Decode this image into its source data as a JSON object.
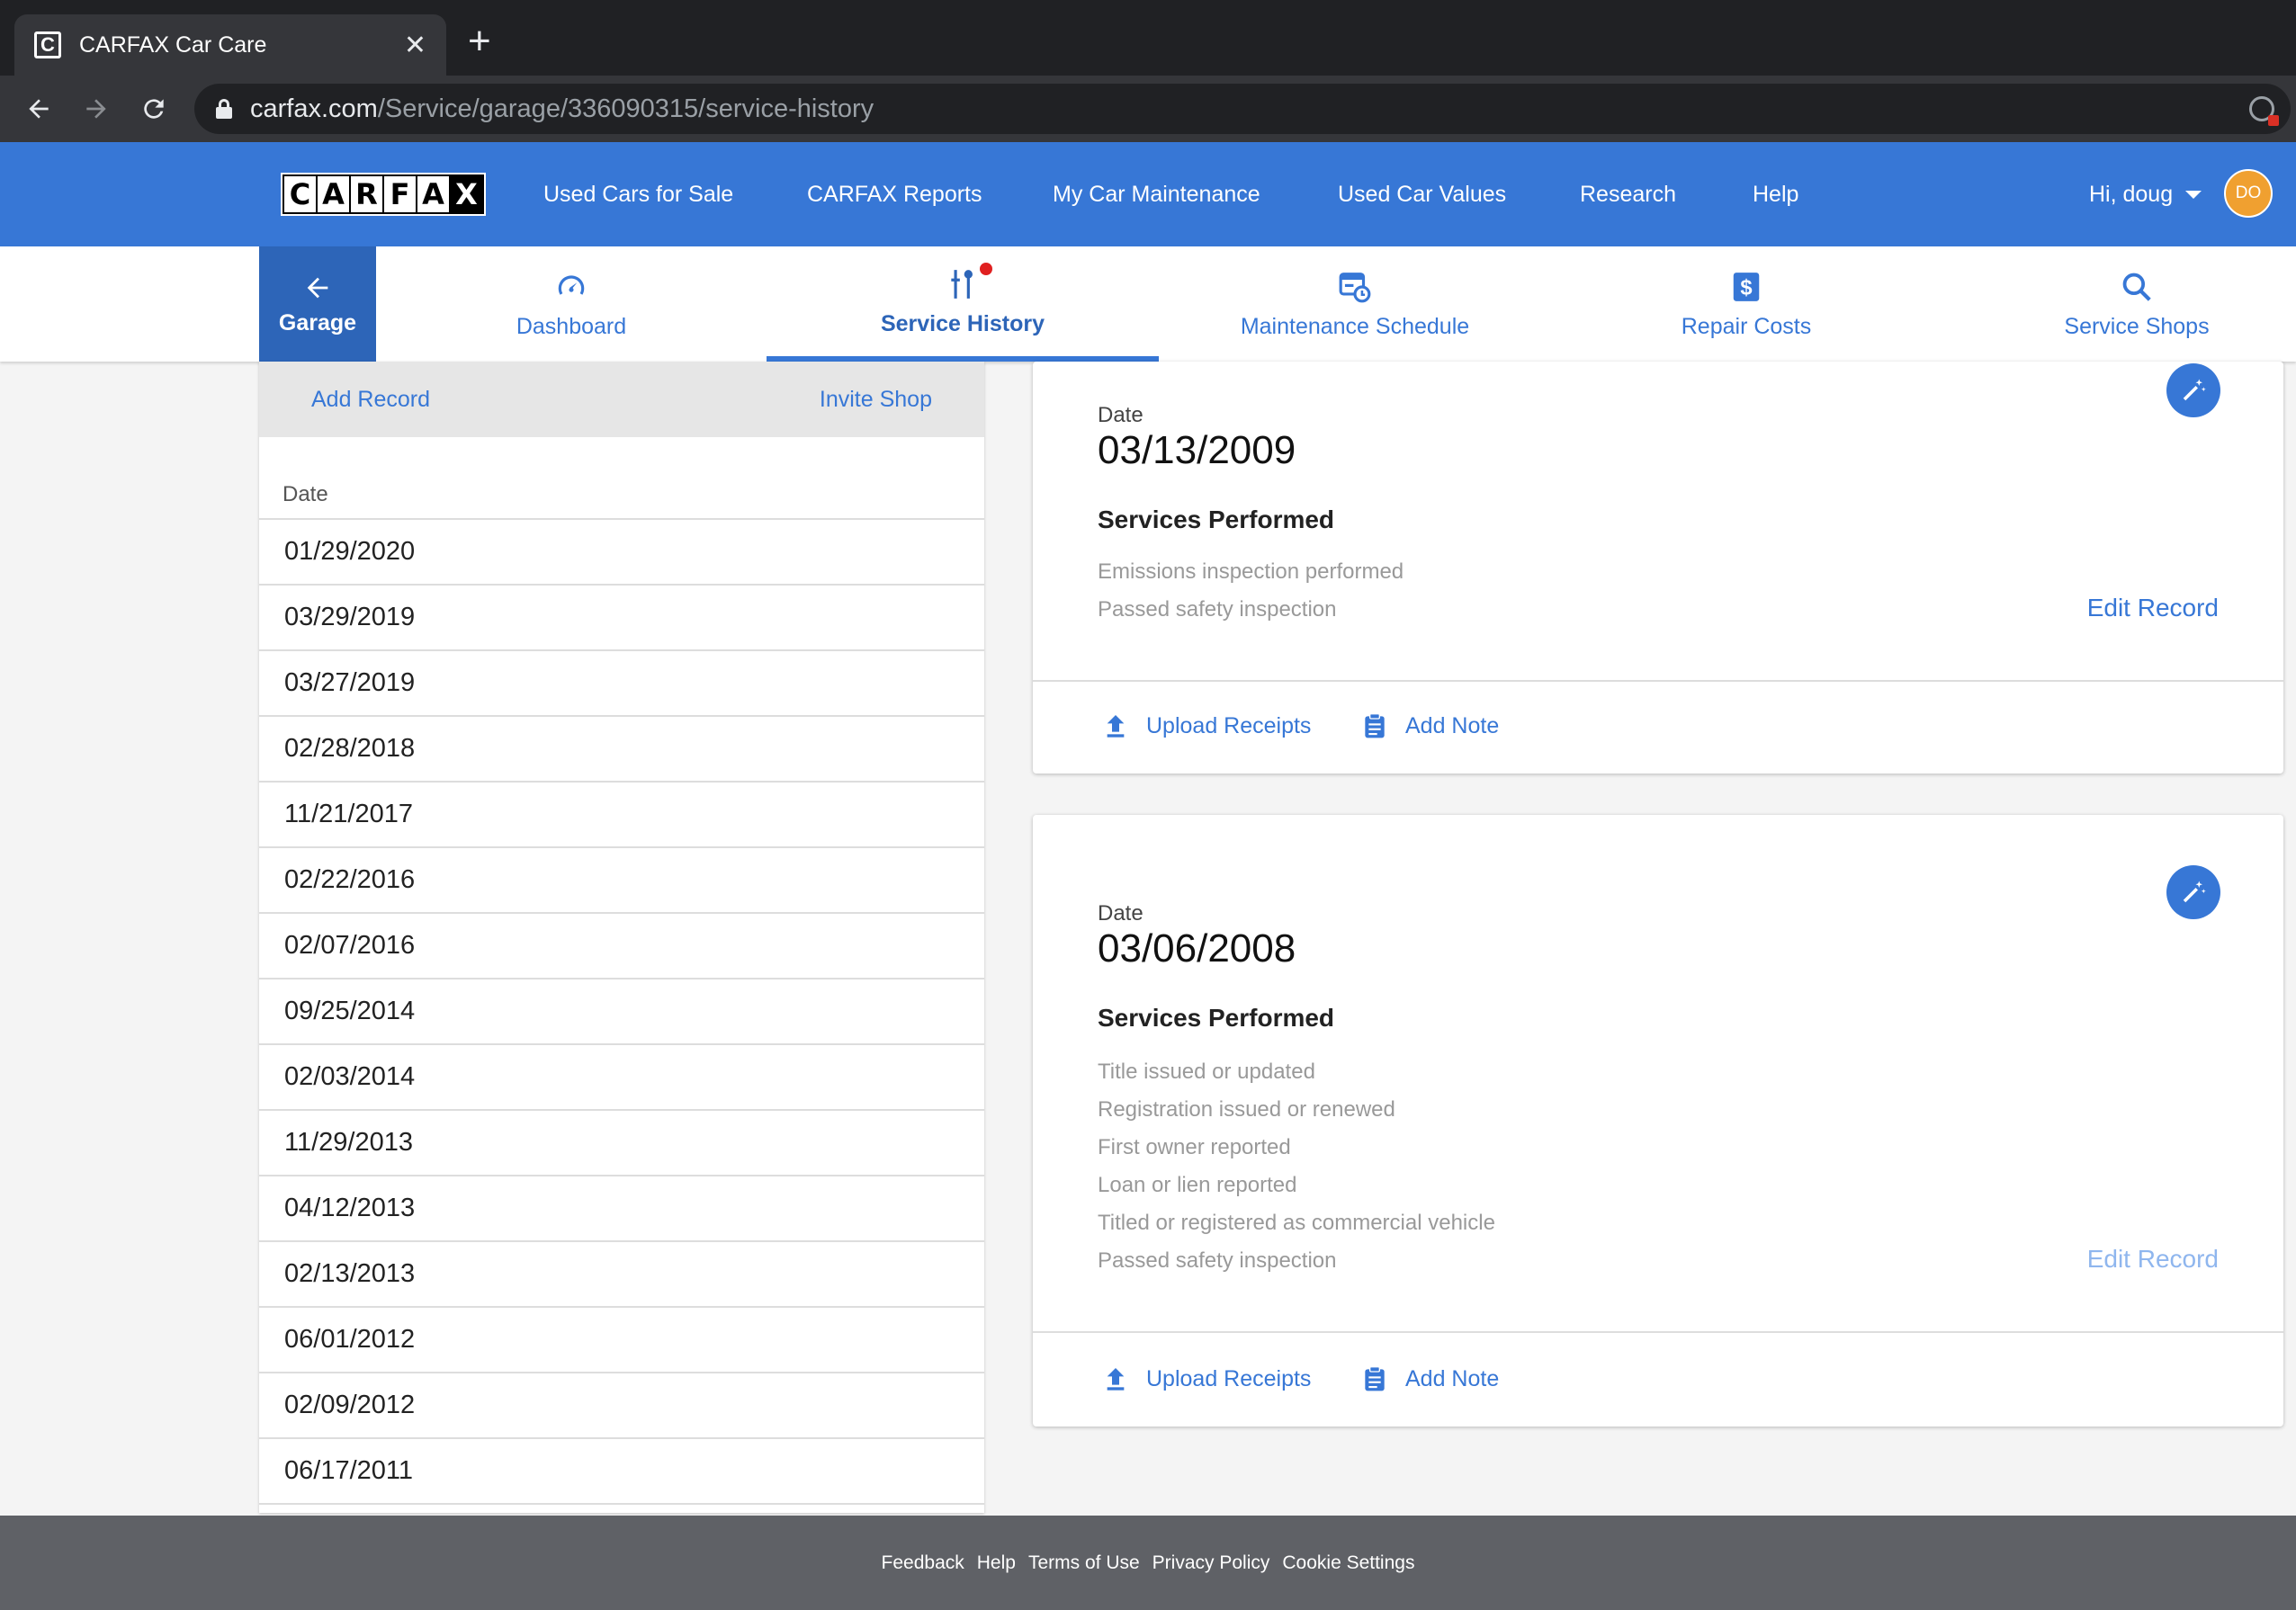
{
  "browser": {
    "tab_title": "CARFAX Car Care",
    "favicon_letter": "C",
    "url_host": "carfax.com",
    "url_path": "/Service/garage/336090315/service-history"
  },
  "header": {
    "logo_letters": [
      "C",
      "A",
      "R",
      "F",
      "A",
      "X"
    ],
    "nav": [
      "Used Cars for Sale",
      "CARFAX Reports",
      "My Car Maintenance",
      "Used Car Values",
      "Research",
      "Help"
    ],
    "greeting": "Hi, doug",
    "avatar_initials": "DO"
  },
  "subnav": {
    "garage_label": "Garage",
    "tabs": [
      {
        "label": "Dashboard",
        "icon": "speedometer-icon"
      },
      {
        "label": "Service History",
        "icon": "tools-icon",
        "active": true
      },
      {
        "label": "Maintenance Schedule",
        "icon": "calendar-clock-icon"
      },
      {
        "label": "Repair Costs",
        "icon": "dollar-icon"
      },
      {
        "label": "Service Shops",
        "icon": "search-icon"
      }
    ]
  },
  "left": {
    "add_record": "Add Record",
    "invite_shop": "Invite Shop",
    "date_header": "Date",
    "dates": [
      "01/29/2020",
      "03/29/2019",
      "03/27/2019",
      "02/28/2018",
      "11/21/2017",
      "02/22/2016",
      "02/07/2016",
      "09/25/2014",
      "02/03/2014",
      "11/29/2013",
      "04/12/2013",
      "02/13/2013",
      "06/01/2012",
      "02/09/2012",
      "06/17/2011"
    ]
  },
  "records": [
    {
      "date_label": "Date",
      "date": "03/13/2009",
      "services_title": "Services Performed",
      "services": [
        "Emissions inspection performed",
        "Passed safety inspection"
      ],
      "edit": "Edit Record",
      "upload": "Upload Receipts",
      "add_note": "Add Note"
    },
    {
      "date_label": "Date",
      "date": "03/06/2008",
      "services_title": "Services Performed",
      "services": [
        "Title issued or updated",
        "Registration issued or renewed",
        "First owner reported",
        "Loan or lien reported",
        "Titled or registered as commercial vehicle",
        "Passed safety inspection"
      ],
      "edit": "Edit Record",
      "upload": "Upload Receipts",
      "add_note": "Add Note"
    }
  ],
  "footer": [
    "Feedback",
    "Help",
    "Terms of Use",
    "Privacy Policy",
    "Cookie Settings"
  ],
  "colors": {
    "brand_blue": "#3777d6",
    "garage_blue": "#2d65b8",
    "avatar_orange": "#f0a030",
    "footer_gray": "#5f6166"
  }
}
